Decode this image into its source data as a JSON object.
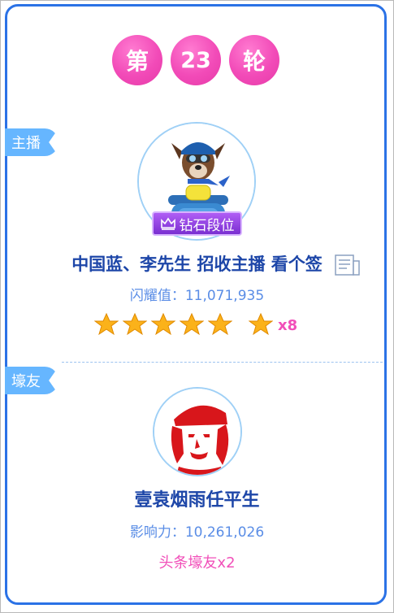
{
  "round": {
    "prefix": "第",
    "number": "23",
    "suffix": "轮"
  },
  "host": {
    "tag": "主播",
    "badge": "钻石段位",
    "name": "中国蓝、李先生 招收主播 看个签",
    "shine_label": "闪耀值：11,071,935",
    "stars_rating": 5,
    "bonus_star_count": "x8"
  },
  "fan": {
    "tag": "壕友",
    "name": "壹袁烟雨任平生",
    "influence_label": "影响力：10,261,026",
    "headline": "头条壕友x2"
  },
  "colors": {
    "accent_pink": "#f14fb9",
    "border_blue": "#2b72e6",
    "tag_blue": "#66b6ff",
    "name_blue": "#1d46a8"
  }
}
